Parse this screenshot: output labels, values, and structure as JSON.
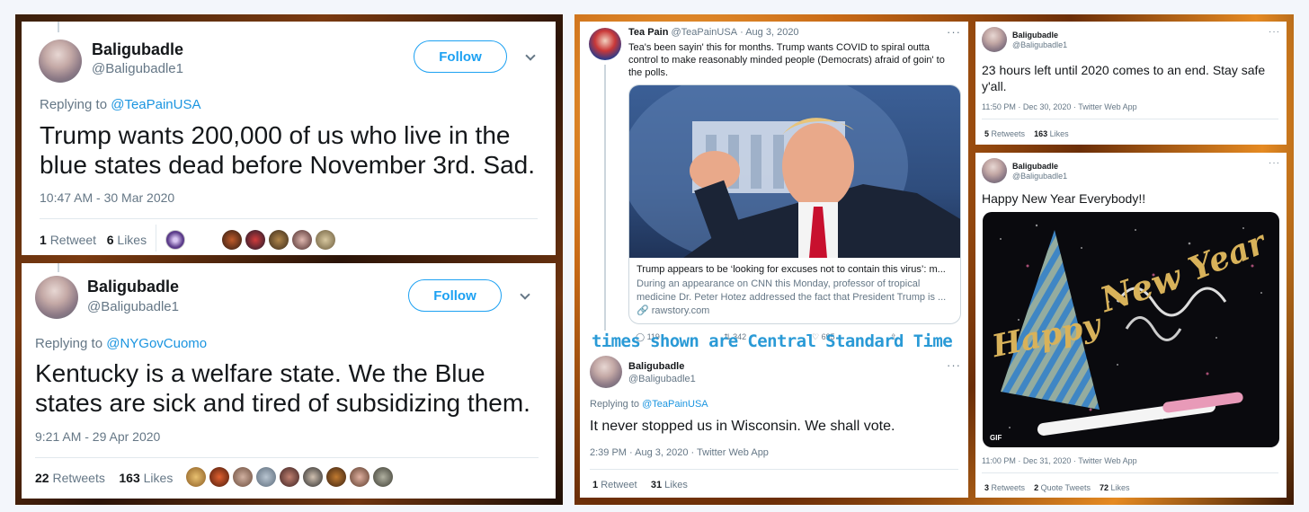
{
  "tweet1": {
    "name": "Baligubadle",
    "handle": "@Baligubadle1",
    "follow_label": "Follow",
    "replying_prefix": "Replying to",
    "replying_to": "@TeaPainUSA",
    "text": "Trump wants 200,000 of us who live in the blue states dead before November 3rd. Sad.",
    "timestamp": "10:47 AM - 30 Mar 2020",
    "retweet_count": "1",
    "retweet_label": "Retweet",
    "like_count": "6",
    "like_label": "Likes"
  },
  "tweet2": {
    "name": "Baligubadle",
    "handle": "@Baligubadle1",
    "follow_label": "Follow",
    "replying_prefix": "Replying to",
    "replying_to": "@NYGovCuomo",
    "text": "Kentucky is a welfare state. We the Blue states are sick and tired of subsidizing them.",
    "timestamp": "9:21 AM - 29 Apr 2020",
    "retweet_count": "22",
    "retweet_label": "Retweets",
    "like_count": "163",
    "like_label": "Likes"
  },
  "teapain": {
    "name": "Tea Pain",
    "handle": "@TeaPainUSA",
    "date": "· Aug 3, 2020",
    "text": "Tea's been sayin' this for months.  Trump wants COVID to spiral outta control to make reasonably minded people (Democrats) afraid of goin' to the polls.",
    "card_title": "Trump appears to be ‘looking for excuses not to contain this virus’: m...",
    "card_desc": "During an appearance on CNN this Monday, professor of tropical medicine Dr. Peter Hotez addressed the fact that President Trump is ...",
    "card_domain": "rawstory.com",
    "reply_count": "119",
    "retweet_count": "342",
    "like_count": "695",
    "more": "···"
  },
  "overlay_note": "times shown are Central Standard Time",
  "reply3": {
    "name": "Baligubadle",
    "handle": "@Baligubadle1",
    "replying_prefix": "Replying to",
    "replying_to": "@TeaPainUSA",
    "text": "It never stopped us in Wisconsin. We shall vote.",
    "meta": "2:39 PM · Aug 3, 2020 · Twitter Web App",
    "retweet_count": "1",
    "retweet_label": "Retweet",
    "like_count": "31",
    "like_label": "Likes",
    "more": "···"
  },
  "tweet4": {
    "name": "Baligubadle",
    "handle": "@Baligubadle1",
    "text": "23 hours left until 2020 comes to an end. Stay safe y'all.",
    "meta": "11:50 PM · Dec 30, 2020 · Twitter Web App",
    "retweet_count": "5",
    "retweet_label": "Retweets",
    "like_count": "163",
    "like_label": "Likes",
    "more": "···"
  },
  "tweet5": {
    "name": "Baligubadle",
    "handle": "@Baligubadle1",
    "text": "Happy New Year Everybody!!",
    "gif_badge": "GIF",
    "gif_text_1": "Happy",
    "gif_text_2": "New",
    "gif_text_3": "Year",
    "meta": "11:00 PM · Dec 31, 2020 · Twitter Web App",
    "retweet_count": "3",
    "retweet_label": "Retweets",
    "quote_count": "2",
    "quote_label": "Quote Tweets",
    "like_count": "72",
    "like_label": "Likes",
    "more": "···"
  },
  "colors": {
    "twitter_blue": "#1da1f2",
    "link_blue": "#1b95e0",
    "meta_gray": "#657786",
    "overlay_blue": "#2a9ad6"
  }
}
